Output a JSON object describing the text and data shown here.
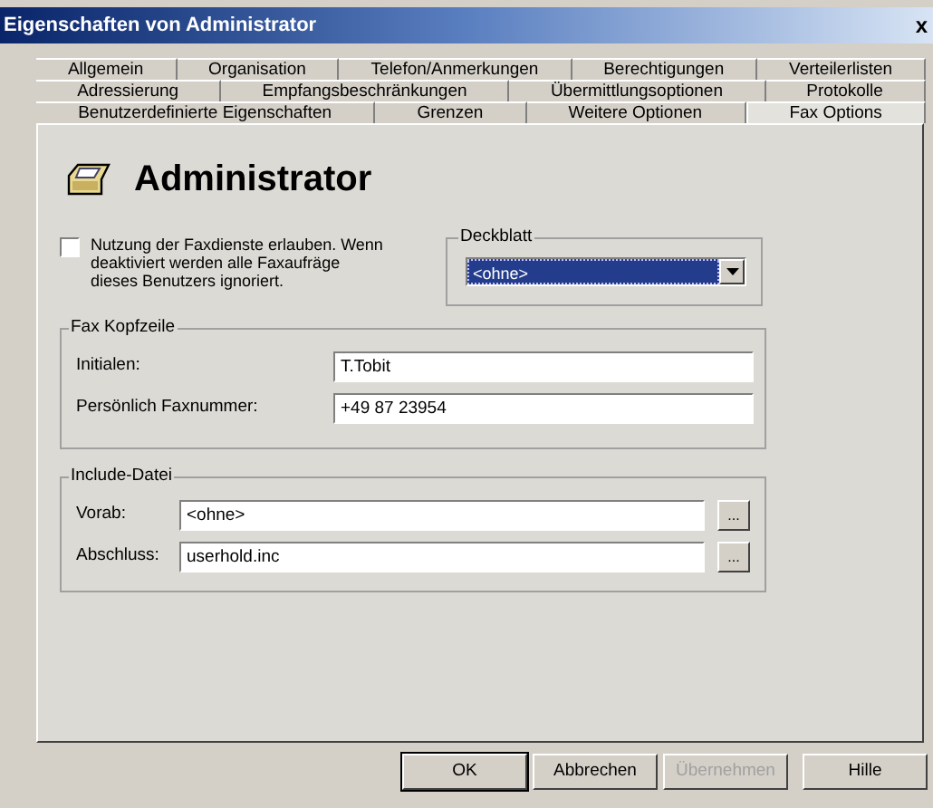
{
  "window": {
    "title": "Eigenschaften von Administrator",
    "close": "x"
  },
  "tab_rows": [
    [
      {
        "label": "Allgemein",
        "selected": false
      },
      {
        "label": "Organisation",
        "selected": false
      },
      {
        "label": "Telefon/Anmerkungen",
        "selected": false
      },
      {
        "label": "Berechtigungen",
        "selected": false
      },
      {
        "label": "Verteilerlisten",
        "selected": false
      }
    ],
    [
      {
        "label": "Adressierung",
        "selected": false
      },
      {
        "label": "Empfangsbeschränkungen",
        "selected": false
      },
      {
        "label": "Übermittlungsoptionen",
        "selected": false
      },
      {
        "label": "Protokolle",
        "selected": false
      }
    ],
    [
      {
        "label": "Benutzerdefinierte Eigenschaften",
        "selected": false
      },
      {
        "label": "Grenzen",
        "selected": false
      },
      {
        "label": "Weitere Optionen",
        "selected": false
      },
      {
        "label": "Fax Options",
        "selected": true
      }
    ]
  ],
  "header": {
    "name": "Administrator"
  },
  "fax_enable": {
    "label": "Nutzung der Faxdienste erlauben. Wenn deaktiviert werden alle Faxaufräge dieses Benutzers ignoriert.",
    "checked": false
  },
  "deckblatt": {
    "title": "Deckblatt",
    "value": "<ohne>"
  },
  "fax_kopfzeile": {
    "title": "Fax Kopfzeile",
    "fields": [
      {
        "label": "Initialen:",
        "value": "T.Tobit"
      },
      {
        "label": "Persönlich Faxnummer:",
        "value": "+49 87 23954"
      }
    ]
  },
  "include_datei": {
    "title": "Include-Datei",
    "fields": [
      {
        "label": "Vorab:",
        "value": "<ohne>",
        "browse": "..."
      },
      {
        "label": "Abschluss:",
        "value": "userhold.inc",
        "browse": "..."
      }
    ]
  },
  "buttons": [
    {
      "label": "OK",
      "disabled": false,
      "default": true
    },
    {
      "label": "Abbrechen",
      "disabled": false,
      "default": false
    },
    {
      "label": "Übernehmen",
      "disabled": true,
      "default": false
    },
    {
      "label": "Hille",
      "disabled": false,
      "default": false
    }
  ]
}
